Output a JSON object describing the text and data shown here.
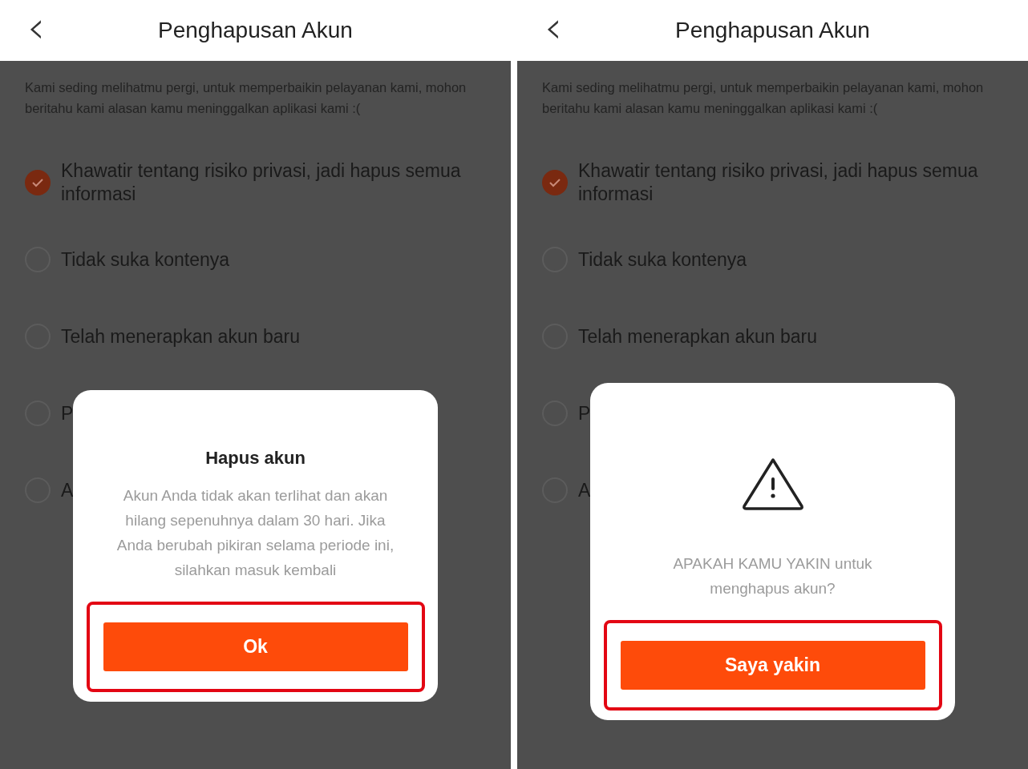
{
  "screens": [
    {
      "header": {
        "back": "‹",
        "title": "Penghapusan Akun"
      },
      "intro": "Kami seding melihatmu pergi, untuk memperbaikin pelayanan kami, mohon beritahu kami alasan kamu meninggalkan aplikasi kami :(",
      "options": [
        {
          "label": "Khawatir tentang risiko privasi, jadi hapus semua informasi",
          "selected": true
        },
        {
          "label": "Tidak suka kontenya",
          "selected": false
        },
        {
          "label": "Telah menerapkan akun baru",
          "selected": false
        },
        {
          "label": "P",
          "selected": false
        },
        {
          "label": "A",
          "selected": false
        }
      ],
      "dialog": {
        "kind": "notice",
        "title": "Hapus akun",
        "message": "Akun Anda tidak akan terlihat dan akan hilang sepenuhnya dalam 30 hari. Jika Anda berubah pikiran selama periode ini, silahkan masuk kembali",
        "button": {
          "label": "Ok",
          "highlighted": true
        }
      }
    },
    {
      "header": {
        "back": "‹",
        "title": "Penghapusan Akun"
      },
      "intro": "Kami seding melihatmu pergi, untuk memperbaikin pelayanan kami, mohon beritahu kami alasan kamu meninggalkan aplikasi kami :(",
      "options": [
        {
          "label": "Khawatir tentang risiko privasi, jadi hapus semua informasi",
          "selected": true
        },
        {
          "label": "Tidak suka kontenya",
          "selected": false
        },
        {
          "label": "Telah menerapkan akun baru",
          "selected": false
        },
        {
          "label": "P",
          "selected": false
        },
        {
          "label": "A",
          "selected": false
        }
      ],
      "dialog": {
        "kind": "warning",
        "message": "APAKAH KAMU YAKIN untuk menghapus akun?",
        "button": {
          "label": "Saya yakin",
          "highlighted": true
        }
      }
    }
  ]
}
